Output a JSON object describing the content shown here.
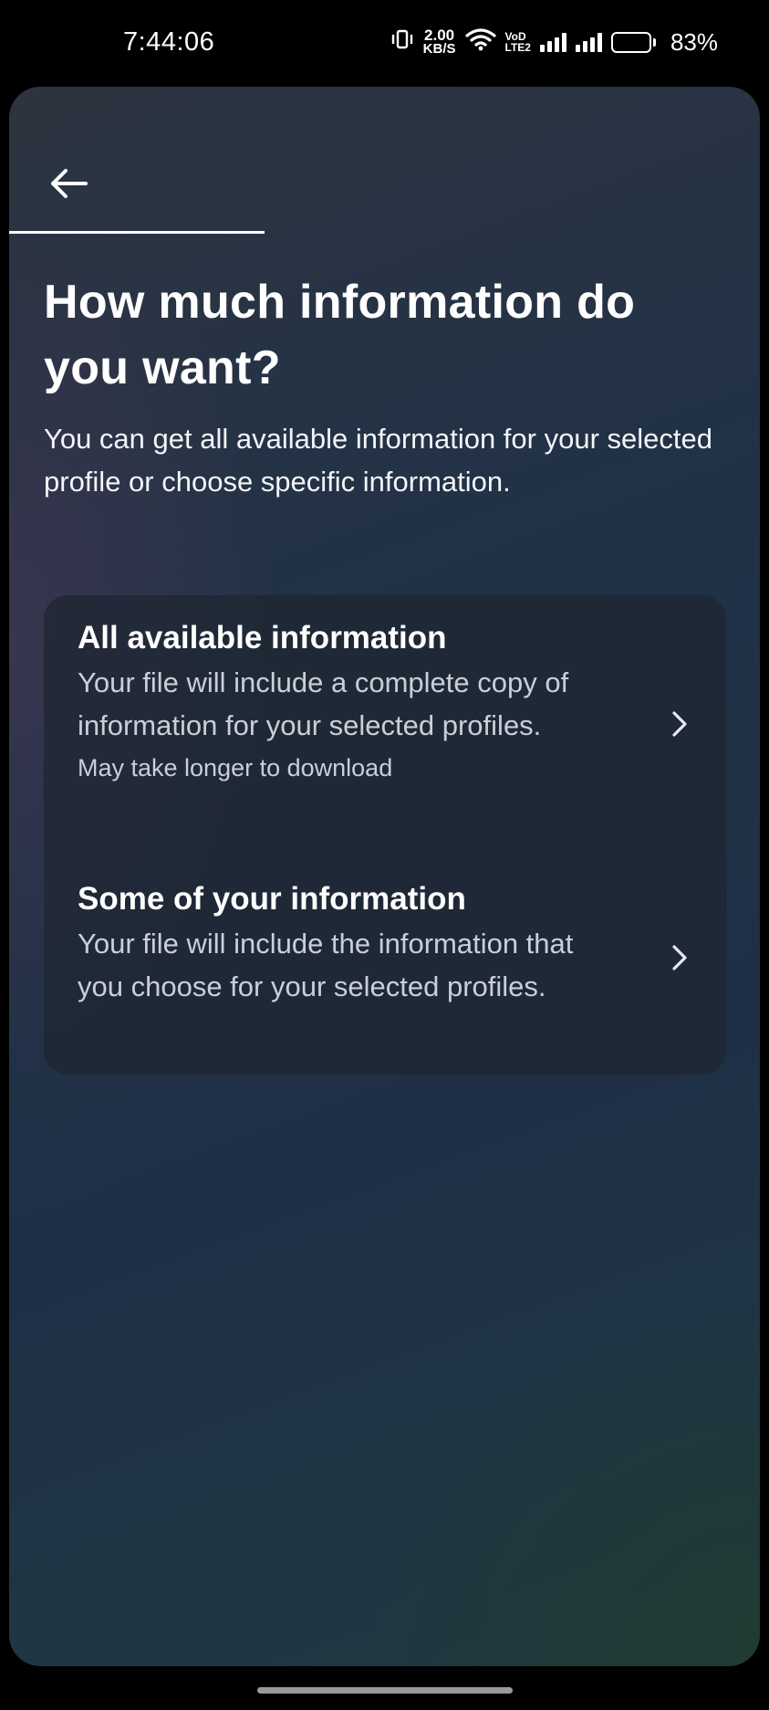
{
  "status_bar": {
    "time": "7:44:06",
    "network_speed_value": "2.00",
    "network_speed_unit": "KB/S",
    "volte_top": "VoD",
    "volte_bottom": "LTE2",
    "battery_percent": "83%",
    "battery_level": 0.83
  },
  "header": {
    "back_icon": "arrow-left-icon",
    "progress": 0.34
  },
  "page": {
    "title": "How much information do you want?",
    "subtitle": "You can get all available information for your selected profile or choose specific information."
  },
  "options": [
    {
      "title": "All available information",
      "description": "Your file will include a complete copy of information for your selected profiles.",
      "note": "May take longer to download",
      "icon": "chevron-right-icon"
    },
    {
      "title": "Some of your information",
      "description": "Your file will include the information that you choose for your selected profiles.",
      "icon": "chevron-right-icon"
    }
  ],
  "colors": {
    "text_primary": "#ffffff",
    "text_secondary": "#c9cfd7",
    "card_bg": "#1e2630"
  }
}
